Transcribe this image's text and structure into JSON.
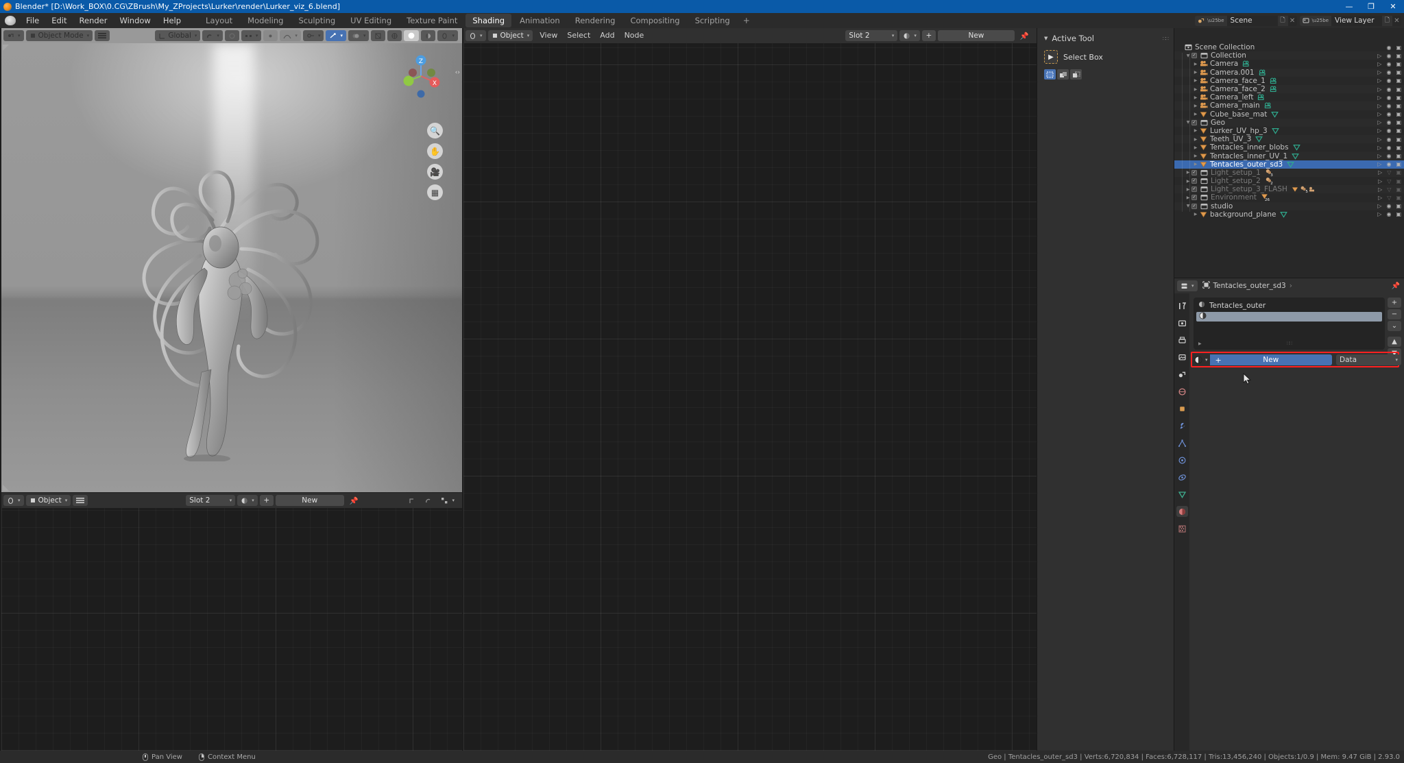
{
  "titlebar": {
    "app_title": "Blender* [D:\\Work_BOX\\0.CG\\ZBrush\\My_ZProjects\\Lurker\\render\\Lurker_viz_6.blend]",
    "minimize": "—",
    "maximize": "❐",
    "close": "✕"
  },
  "topbar": {
    "menus": [
      "File",
      "Edit",
      "Render",
      "Window",
      "Help"
    ],
    "workspaces": [
      {
        "label": "Layout",
        "active": false
      },
      {
        "label": "Modeling",
        "active": false
      },
      {
        "label": "Sculpting",
        "active": false
      },
      {
        "label": "UV Editing",
        "active": false
      },
      {
        "label": "Texture Paint",
        "active": false
      },
      {
        "label": "Shading",
        "active": true
      },
      {
        "label": "Animation",
        "active": false
      },
      {
        "label": "Rendering",
        "active": false
      },
      {
        "label": "Compositing",
        "active": false
      },
      {
        "label": "Scripting",
        "active": false
      }
    ],
    "add_workspace": "+",
    "scene_name": "Scene",
    "view_layer_name": "View Layer",
    "scene_icon": "scene-icon",
    "view_layer_icon": "view-layer-icon",
    "copy_icon": "duplicate-icon",
    "unlink_icon": "unlink-x-icon"
  },
  "viewport_header": {
    "editor_type_icon": "editor-type-3dview-icon",
    "mode": "Object Mode",
    "mode_icon": "object-mode-icon",
    "menu_icon": "collapsed-menus-icon",
    "transform_orientation": "Global",
    "orientation_icon": "orientation-icon",
    "snap_icon": "snap-magnet-icon",
    "proportional_icon": "proportional-edit-icon",
    "proportional_falloff_icon": "falloff-curve-icon",
    "gizmo_icon": "gizmo-icon",
    "overlays_icon": "overlays-icon",
    "xray_icon": "xray-toggle-icon",
    "shading_solid_icon": "shading-solid-icon",
    "shading_wire_icon": "shading-wireframe-icon",
    "shading_material_icon": "shading-material-icon",
    "shading_rendered_icon": "shading-rendered-icon"
  },
  "viewport": {
    "gizmo_axes": [
      "X",
      "Y",
      "Z"
    ],
    "nav_buttons": [
      "zoom-icon",
      "hand-pan-icon",
      "camera-view-icon",
      "orthographic-toggle-icon"
    ],
    "sidebar_arrow": "‹›"
  },
  "npanel": {
    "title": "Active Tool",
    "collapse_icon": "triangle-down-icon",
    "grip_icon": "grip-dots-icon",
    "tool_icon": "select-box-icon",
    "tool_name": "Select Box",
    "mode_buttons": [
      "select-set-icon",
      "select-extend-icon",
      "select-subtract-icon"
    ]
  },
  "shader_header": {
    "editor_type_icon": "editor-type-shader-icon",
    "shader_type": "Object",
    "shader_type_icon": "object-icon",
    "menus": [
      "View",
      "Select",
      "Add",
      "Node"
    ],
    "slot": "Slot 2",
    "material_browse_icon": "material-browse-icon",
    "add_icon": "+",
    "new_label": "New",
    "pin_icon": "pin-icon"
  },
  "bottom_shader_header": {
    "editor_type_icon": "editor-type-shader-icon",
    "shader_type": "Object",
    "shader_type_icon": "object-icon",
    "menu_icon": "collapsed-menus-icon",
    "slot": "Slot 2",
    "material_browse_icon": "material-browse-icon",
    "add_icon": "+",
    "new_label": "New",
    "pin_icon": "pin-icon",
    "snap_icon": "snap-icon",
    "proportional_icon": "proportional-edit-icon",
    "overlay_icon": "node-overlay-icon"
  },
  "outliner_header": {
    "display_mode_icon": "outliner-display-mode-icon",
    "filter_id_icon": "filter-id-type-icon",
    "search_icon": "search-icon",
    "search_value": "",
    "search_placeholder": "",
    "filter_icon": "funnel-filter-icon",
    "new_collection_icon": "new-collection-icon"
  },
  "outliner": {
    "rows": [
      {
        "indent": 0,
        "name": "Scene Collection",
        "icon": "scene-collection-icon",
        "checkbox": false,
        "disclosure": "",
        "datatype": "",
        "selected": false,
        "dim": false,
        "eye": "on",
        "camera": "on",
        "cursor": false
      },
      {
        "indent": 1,
        "name": "Collection",
        "icon": "collection-icon",
        "checkbox": true,
        "disclosure": "down",
        "datatype": "",
        "selected": false,
        "dim": false,
        "eye": "on",
        "camera": "on",
        "cursor": true
      },
      {
        "indent": 2,
        "name": "Camera",
        "icon": "camera-obj-icon",
        "checkbox": false,
        "disclosure": "right",
        "datatype": "camera-data-icon",
        "selected": false,
        "dim": false,
        "eye": "on",
        "camera": "on",
        "cursor": true
      },
      {
        "indent": 2,
        "name": "Camera.001",
        "icon": "camera-obj-icon",
        "checkbox": false,
        "disclosure": "right",
        "datatype": "camera-data-icon",
        "selected": false,
        "dim": false,
        "eye": "on",
        "camera": "on",
        "cursor": true
      },
      {
        "indent": 2,
        "name": "Camera_face_1",
        "icon": "camera-obj-icon",
        "checkbox": false,
        "disclosure": "right",
        "datatype": "camera-data-icon",
        "selected": false,
        "dim": false,
        "eye": "on",
        "camera": "on",
        "cursor": true
      },
      {
        "indent": 2,
        "name": "Camera_face_2",
        "icon": "camera-obj-icon",
        "checkbox": false,
        "disclosure": "right",
        "datatype": "camera-data-icon",
        "selected": false,
        "dim": false,
        "eye": "on",
        "camera": "on",
        "cursor": true
      },
      {
        "indent": 2,
        "name": "Camera_left",
        "icon": "camera-obj-icon",
        "checkbox": false,
        "disclosure": "right",
        "datatype": "camera-data-icon",
        "selected": false,
        "dim": false,
        "eye": "on",
        "camera": "on",
        "cursor": true
      },
      {
        "indent": 2,
        "name": "Camera_main",
        "icon": "camera-obj-icon",
        "checkbox": false,
        "disclosure": "right",
        "datatype": "camera-data-icon",
        "selected": false,
        "dim": false,
        "eye": "on",
        "camera": "on",
        "cursor": true
      },
      {
        "indent": 2,
        "name": "Cube_base_mat",
        "icon": "mesh-obj-icon",
        "checkbox": false,
        "disclosure": "right",
        "datatype": "mesh-data-icon",
        "selected": false,
        "dim": false,
        "eye": "on",
        "camera": "on",
        "cursor": true
      },
      {
        "indent": 1,
        "name": "Geo",
        "icon": "collection-icon",
        "checkbox": true,
        "disclosure": "down",
        "datatype": "",
        "selected": false,
        "dim": false,
        "eye": "on",
        "camera": "on",
        "cursor": true
      },
      {
        "indent": 2,
        "name": "Lurker_UV_hp_3",
        "icon": "mesh-obj-icon",
        "checkbox": false,
        "disclosure": "right",
        "datatype": "mesh-data-icon",
        "selected": false,
        "dim": false,
        "eye": "on",
        "camera": "on",
        "cursor": true
      },
      {
        "indent": 2,
        "name": "Teeth_UV_3",
        "icon": "mesh-obj-icon",
        "checkbox": false,
        "disclosure": "right",
        "datatype": "mesh-data-icon",
        "selected": false,
        "dim": false,
        "eye": "on",
        "camera": "on",
        "cursor": true
      },
      {
        "indent": 2,
        "name": "Tentacles_inner_blobs",
        "icon": "mesh-obj-icon",
        "checkbox": false,
        "disclosure": "right",
        "datatype": "mesh-data-icon",
        "selected": false,
        "dim": false,
        "eye": "on",
        "camera": "on",
        "cursor": true
      },
      {
        "indent": 2,
        "name": "Tentacles_inner_UV_1",
        "icon": "mesh-obj-icon",
        "checkbox": false,
        "disclosure": "right",
        "datatype": "mesh-data-icon",
        "selected": false,
        "dim": false,
        "eye": "on",
        "camera": "on",
        "cursor": true
      },
      {
        "indent": 2,
        "name": "Tentacles_outer_sd3",
        "icon": "mesh-obj-icon",
        "checkbox": false,
        "disclosure": "right",
        "datatype": "mesh-data-icon",
        "selected": true,
        "dim": false,
        "eye": "on",
        "camera": "on",
        "cursor": true
      },
      {
        "indent": 1,
        "name": "Light_setup_1",
        "icon": "collection-icon",
        "checkbox": true,
        "disclosure": "right",
        "datatype": "light-badge-icon",
        "badge": "3",
        "selected": false,
        "dim": true,
        "eye": "closed",
        "camera": "off",
        "cursor": true
      },
      {
        "indent": 1,
        "name": "Light_setup_2",
        "icon": "collection-icon",
        "checkbox": true,
        "disclosure": "right",
        "datatype": "light-badge-icon",
        "badge": "2",
        "selected": false,
        "dim": true,
        "eye": "closed",
        "camera": "off",
        "cursor": true
      },
      {
        "indent": 1,
        "name": "Light_setup_3_FLASH",
        "icon": "collection-icon",
        "checkbox": true,
        "disclosure": "right",
        "datatype": "mixed-badge-icon",
        "badge": "5",
        "selected": false,
        "dim": true,
        "eye": "closed",
        "camera": "off",
        "cursor": true
      },
      {
        "indent": 1,
        "name": "Environment",
        "icon": "collection-icon",
        "checkbox": true,
        "disclosure": "right",
        "datatype": "mesh-badge-icon",
        "badge": "26",
        "selected": false,
        "dim": true,
        "eye": "closed",
        "camera": "off",
        "cursor": true
      },
      {
        "indent": 1,
        "name": "studio",
        "icon": "collection-icon",
        "checkbox": true,
        "disclosure": "down",
        "datatype": "",
        "selected": false,
        "dim": false,
        "eye": "on",
        "camera": "on",
        "cursor": true
      },
      {
        "indent": 2,
        "name": "background_plane",
        "icon": "mesh-obj-icon",
        "checkbox": false,
        "disclosure": "right",
        "datatype": "mesh-data-icon",
        "selected": false,
        "dim": false,
        "eye": "on",
        "camera": "on",
        "cursor": true
      }
    ]
  },
  "properties": {
    "editor_icon": "properties-editor-icon",
    "breadcrumb_icon": "object-icon",
    "breadcrumb_object": "Tentacles_outer_sd3",
    "breadcrumb_sep": "›",
    "pin_icon": "pin-icon",
    "tabs": [
      {
        "name": "tool-tab",
        "icon": "⚒",
        "active": false
      },
      {
        "name": "render-tab",
        "icon": "▣",
        "active": false
      },
      {
        "name": "output-tab",
        "icon": "⎙",
        "active": false
      },
      {
        "name": "view-layer-tab",
        "icon": "▤",
        "active": false
      },
      {
        "name": "scene-tab",
        "icon": "◔",
        "active": false
      },
      {
        "name": "world-tab",
        "icon": "♁",
        "active": false
      },
      {
        "name": "object-tab",
        "icon": "▢",
        "active": false
      },
      {
        "name": "modifier-tab",
        "icon": "ὒ7",
        "active": false
      },
      {
        "name": "particles-tab",
        "icon": "☳",
        "active": false
      },
      {
        "name": "physics-tab",
        "icon": "◌",
        "active": false
      },
      {
        "name": "constraints-tab",
        "icon": "⛓",
        "active": false
      },
      {
        "name": "data-tab",
        "icon": "▽",
        "active": false
      },
      {
        "name": "material-tab",
        "icon": "◕",
        "active": true
      },
      {
        "name": "texture-tab",
        "icon": "▒",
        "active": false
      }
    ],
    "material": {
      "slot_list_label": "Tentacles_outer",
      "slot_list_icon": "material-sphere-icon",
      "active_slot_name": "",
      "active_slot_icon": "material-sphere-icon",
      "side_buttons": [
        "+",
        "−",
        "⌄",
        "▲",
        "▼"
      ],
      "browse_icon": "material-browse-icon",
      "add_label": "+",
      "new_label": "New",
      "link_label": "Data",
      "link_caret": "⌄",
      "highlight_color": "#ff2020",
      "new_button_color": "#4772b3"
    }
  },
  "statusbar": {
    "left_items": [
      {
        "icon": "mouse-middle-icon",
        "label": "Pan View"
      },
      {
        "icon": "mouse-right-icon",
        "label": "Context Menu"
      }
    ],
    "stats": "Geo | Tentacles_outer_sd3 | Verts:6,720,834 | Faces:6,728,117 | Tris:13,456,240 | Objects:1/0.9 | Mem: 9.47 GiB | 2.93.0"
  }
}
